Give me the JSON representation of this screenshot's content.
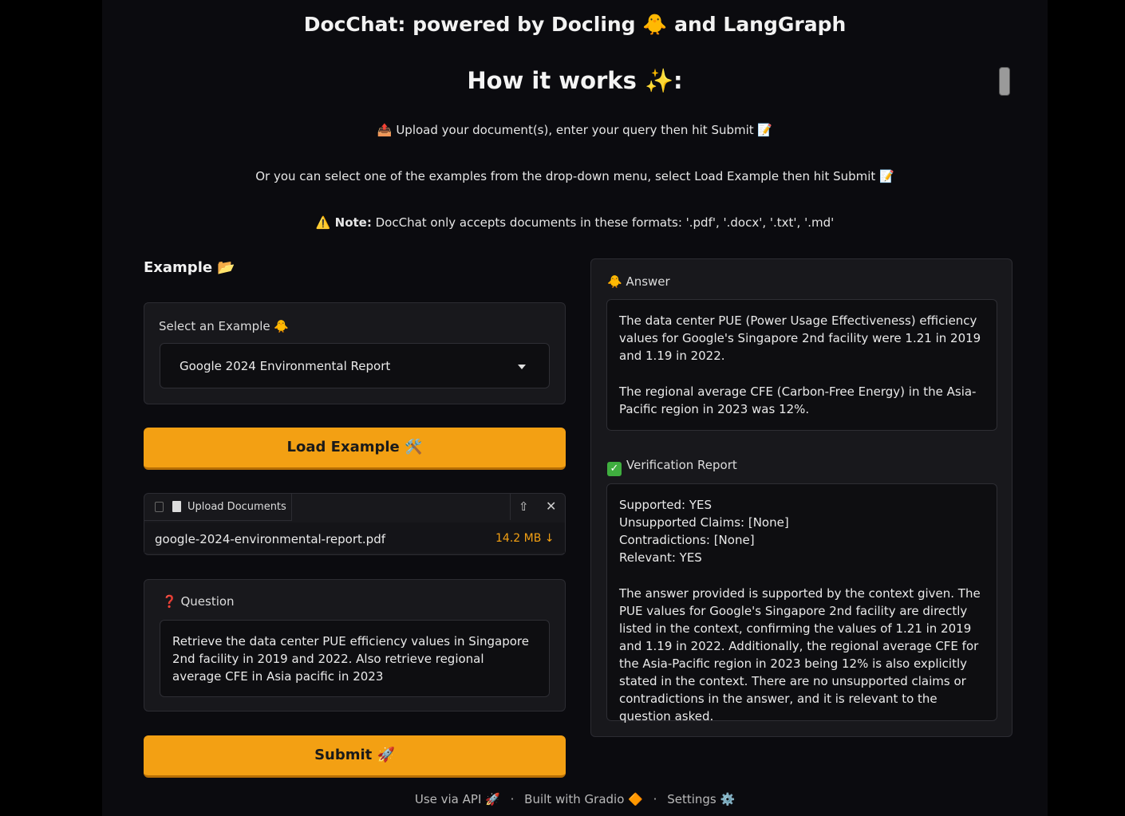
{
  "header": {
    "title": "DocChat: powered by Docling 🐥 and LangGraph",
    "how_it_works": "How it works ✨:",
    "line1": "📤 Upload your document(s), enter your query then hit Submit 📝",
    "line2": "Or you can select one of the examples from the drop-down menu, select Load Example then hit Submit 📝",
    "note_prefix": "⚠️ Note:",
    "note_text": " DocChat only accepts documents in these formats: '.pdf', '.docx', '.txt', '.md'"
  },
  "example": {
    "heading": "Example 📂",
    "select_label": "Select an Example 🐥",
    "selected_value": "Google 2024 Environmental Report",
    "load_button": "Load Example 🛠️"
  },
  "upload": {
    "tab_label": "Upload Documents",
    "file_name": "google-2024-environmental-report.pdf",
    "file_size": "14.2 MB ↓"
  },
  "question": {
    "label": "Question",
    "label_icon": "❓",
    "text": "Retrieve the data center PUE efficiency values in Singapore 2nd facility in 2019 and 2022. Also retrieve regional average CFE in Asia pacific in 2023"
  },
  "submit_button": "Submit 🚀",
  "answer": {
    "label": "🐥 Answer",
    "p1": "The data center PUE (Power Usage Effectiveness) efficiency values for Google's Singapore 2nd facility were 1.21 in 2019 and 1.19 in 2022.",
    "p2": "The regional average CFE (Carbon-Free Energy) in the Asia-Pacific region in 2023 was 12%."
  },
  "verification": {
    "label": "Verification Report",
    "line1": "Supported: YES",
    "line2": "Unsupported Claims: [None]",
    "line3": "Contradictions: [None]",
    "line4": "Relevant: YES",
    "paragraph": "The answer provided is supported by the context given. The PUE values for Google's Singapore 2nd facility are directly listed in the context, confirming the values of 1.21 in 2019 and 1.19 in 2022. Additionally, the regional average CFE for the Asia-Pacific region in 2023 being 12% is also explicitly stated in the context. There are no unsupported claims or contradictions in the answer, and it is relevant to the question asked."
  },
  "footer": {
    "api": "Use via API 🚀",
    "sep": "·",
    "built": "Built with Gradio 🔶",
    "settings": "Settings ⚙️"
  },
  "colors": {
    "accent": "#f3a013",
    "background": "#0b0b0f",
    "panel": "#18181c"
  }
}
